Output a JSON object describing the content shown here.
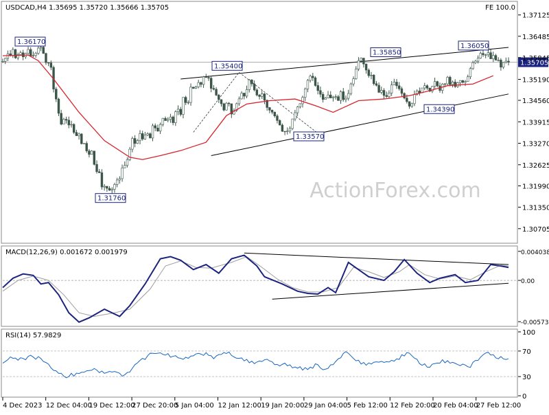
{
  "header": {
    "symbol_text": "USDCAD,H4  1.35695 1.35720 1.35666 1.35705",
    "fe_text": "FE 100.0"
  },
  "watermark": "ActionForex.com",
  "colors": {
    "candle": "#3b5548",
    "ma": "#d8232a",
    "macd_line": "#1a237e",
    "macd_signal": "#9e9e9e",
    "rsi": "#1565c0",
    "trendline": "#000000",
    "label_border": "#1a237e",
    "label_text": "#1a237e",
    "last_price_bg": "#1a237e",
    "watermark": "#cfcfcf"
  },
  "chart_data": [
    {
      "type": "candlestick",
      "panel": "price",
      "title": "USDCAD,H4",
      "ohlc_header": {
        "open": 1.35695,
        "high": 1.3572,
        "low": 1.35666,
        "close": 1.35705
      },
      "last_price": 1.35705,
      "ylim": [
        1.3035,
        1.3745
      ],
      "y_ticks": [
        1.37125,
        1.36485,
        1.35845,
        1.3519,
        1.3456,
        1.33915,
        1.3327,
        1.32625,
        1.3199,
        1.3135,
        1.30705
      ],
      "y_tick_labels": [
        "1.37125",
        "1.36485",
        "1.35845",
        "1.35190",
        "1.34560",
        "1.33915",
        "1.33270",
        "1.32625",
        "1.31990",
        "1.31350",
        "1.30705"
      ],
      "x_labels": [
        "4 Dec 2023",
        "12 Dec 04:00",
        "19 Dec 12:00",
        "27 Dec 20:00",
        "5 Jan 04:00",
        "12 Jan 12:00",
        "19 Jan 20:00",
        "29 Jan 04:00",
        "5 Feb 12:00",
        "12 Feb 20:00",
        "20 Feb 04:00",
        "27 Feb 12:00"
      ],
      "price_path": [
        [
          1.3575,
          1.3595,
          1.359,
          1.3605,
          1.358,
          1.36,
          1.359,
          1.361,
          1.359,
          1.3585,
          1.36,
          1.3617,
          1.359,
          1.357
        ],
        [
          1.356,
          1.347,
          1.344,
          1.339,
          1.34,
          1.338,
          1.339,
          1.335,
          1.336,
          1.332,
          1.333,
          1.329
        ],
        [
          1.33,
          1.325,
          1.324,
          1.32,
          1.319,
          1.3176,
          1.3185,
          1.32,
          1.322,
          1.325,
          1.327
        ],
        [
          1.33,
          1.334,
          1.332,
          1.336,
          1.333,
          1.337,
          1.334,
          1.339,
          1.335,
          1.338,
          1.34
        ],
        [
          1.338,
          1.341,
          1.339,
          1.344,
          1.341,
          1.347,
          1.344,
          1.35,
          1.348,
          1.352
        ],
        [
          1.351,
          1.354,
          1.352,
          1.35,
          1.348,
          1.347,
          1.344,
          1.343,
          1.345,
          1.342,
          1.344
        ],
        [
          1.346,
          1.348,
          1.347,
          1.351,
          1.35,
          1.348,
          1.346,
          1.347,
          1.344,
          1.343
        ],
        [
          1.342,
          1.34,
          1.338,
          1.337,
          1.3357,
          1.337,
          1.34,
          1.342
        ],
        [
          1.345,
          1.347,
          1.35,
          1.353,
          1.351,
          1.348,
          1.347,
          1.346,
          1.347,
          1.346
        ],
        [
          1.347,
          1.346,
          1.348,
          1.345,
          1.347,
          1.35,
          1.353,
          1.357,
          1.3585,
          1.356
        ],
        [
          1.354,
          1.352,
          1.35,
          1.348,
          1.349,
          1.347,
          1.348,
          1.35,
          1.351
        ],
        [
          1.349,
          1.347,
          1.345,
          1.3439,
          1.346,
          1.348,
          1.347,
          1.349
        ],
        [
          1.35,
          1.349,
          1.351,
          1.35,
          1.349,
          1.35,
          1.352
        ],
        [
          1.351,
          1.35,
          1.351,
          1.352,
          1.351,
          1.353,
          1.355,
          1.357,
          1.359,
          1.3605
        ],
        [
          1.359,
          1.36,
          1.358,
          1.359,
          1.357,
          1.356,
          1.3575,
          1.357
        ]
      ],
      "annotations": [
        {
          "text": "1.36170",
          "price": 1.3617,
          "position": "top-left"
        },
        {
          "text": "1.31760",
          "price": 1.3176,
          "position": "bottom"
        },
        {
          "text": "1.35400",
          "price": 1.354,
          "position": "upper-middle"
        },
        {
          "text": "1.33570",
          "price": 1.3357,
          "position": "lower-middle"
        },
        {
          "text": "1.35850",
          "price": 1.3585,
          "position": "upper-right"
        },
        {
          "text": "1.34390",
          "price": 1.3439,
          "position": "right"
        },
        {
          "text": "1.36050",
          "price": 1.3605,
          "position": "top-right"
        }
      ],
      "moving_average": {
        "color": "#d8232a",
        "points": [
          [
            0,
            1.359
          ],
          [
            10,
            1.3592
          ],
          [
            14,
            1.3575
          ],
          [
            20,
            1.352
          ],
          [
            30,
            1.342
          ],
          [
            40,
            1.3335
          ],
          [
            50,
            1.3285
          ],
          [
            55,
            1.3278
          ],
          [
            62,
            1.329
          ],
          [
            70,
            1.3305
          ],
          [
            80,
            1.333
          ],
          [
            88,
            1.341
          ],
          [
            96,
            1.3445
          ],
          [
            105,
            1.3455
          ],
          [
            115,
            1.346
          ],
          [
            123,
            1.344
          ],
          [
            130,
            1.342
          ],
          [
            140,
            1.3455
          ],
          [
            150,
            1.346
          ],
          [
            160,
            1.347
          ],
          [
            168,
            1.3485
          ],
          [
            175,
            1.35
          ],
          [
            185,
            1.3505
          ],
          [
            193,
            1.353
          ]
        ]
      },
      "trendlines": [
        {
          "kind": "upper-channel",
          "from": [
            70,
            1.352
          ],
          "to": [
            199,
            1.3615
          ]
        },
        {
          "kind": "lower-channel",
          "from": [
            82,
            1.329
          ],
          "to": [
            199,
            1.3475
          ]
        }
      ],
      "dashed_lines": [
        {
          "from": [
            75,
            1.336
          ],
          "to": [
            93,
            1.354
          ]
        },
        {
          "from": [
            93,
            1.354
          ],
          "to": [
            124,
            1.3357
          ]
        }
      ]
    },
    {
      "type": "line",
      "panel": "macd",
      "title": "MACD(12,26,9) 0.001672 0.001979",
      "macd": 0.001672,
      "signal_value": 0.001979,
      "ylim": [
        -0.0061,
        0.0044
      ],
      "y_ticks": [
        0.004038,
        0.0,
        -0.005737
      ],
      "y_tick_labels": [
        "0.004038",
        "0.00",
        "-0.005737"
      ],
      "macd_line": [
        [
          0,
          -0.001
        ],
        [
          4,
          0.0003
        ],
        [
          8,
          0.0009
        ],
        [
          12,
          0.0007
        ],
        [
          15,
          -0.0005
        ],
        [
          18,
          -0.0003
        ],
        [
          22,
          -0.002
        ],
        [
          26,
          -0.0045
        ],
        [
          30,
          -0.0058
        ],
        [
          34,
          -0.0052
        ],
        [
          40,
          -0.004
        ],
        [
          46,
          -0.005
        ],
        [
          50,
          -0.0035
        ],
        [
          56,
          -0.0005
        ],
        [
          62,
          0.003
        ],
        [
          66,
          0.0033
        ],
        [
          70,
          0.0028
        ],
        [
          75,
          0.0015
        ],
        [
          80,
          0.0022
        ],
        [
          85,
          0.001
        ],
        [
          90,
          0.003
        ],
        [
          95,
          0.0035
        ],
        [
          100,
          0.002
        ],
        [
          103,
          0.0005
        ],
        [
          110,
          -0.0005
        ],
        [
          116,
          -0.0015
        ],
        [
          120,
          -0.0018
        ],
        [
          124,
          -0.0019
        ],
        [
          128,
          -0.001
        ],
        [
          131,
          -0.0017
        ],
        [
          136,
          0.0025
        ],
        [
          140,
          0.0015
        ],
        [
          144,
          0.0005
        ],
        [
          150,
          0.0
        ],
        [
          154,
          0.0012
        ],
        [
          158,
          0.0029
        ],
        [
          163,
          0.001
        ],
        [
          168,
          -0.0003
        ],
        [
          172,
          0.0003
        ],
        [
          178,
          0.0008
        ],
        [
          182,
          -0.0003
        ],
        [
          187,
          0.0
        ],
        [
          192,
          0.0022
        ],
        [
          196,
          0.002
        ],
        [
          199,
          0.0018
        ]
      ],
      "signal_line": [
        [
          0,
          -0.0015
        ],
        [
          6,
          0.0
        ],
        [
          12,
          0.0006
        ],
        [
          18,
          0.0
        ],
        [
          24,
          -0.002
        ],
        [
          30,
          -0.0045
        ],
        [
          36,
          -0.005
        ],
        [
          44,
          -0.0045
        ],
        [
          50,
          -0.004
        ],
        [
          58,
          -0.0012
        ],
        [
          64,
          0.002
        ],
        [
          70,
          0.0027
        ],
        [
          76,
          0.0018
        ],
        [
          82,
          0.0017
        ],
        [
          90,
          0.0025
        ],
        [
          96,
          0.0033
        ],
        [
          102,
          0.0018
        ],
        [
          108,
          0.0002
        ],
        [
          114,
          -0.001
        ],
        [
          120,
          -0.0016
        ],
        [
          126,
          -0.0016
        ],
        [
          132,
          -0.001
        ],
        [
          138,
          0.0018
        ],
        [
          144,
          0.0012
        ],
        [
          150,
          0.0004
        ],
        [
          156,
          0.0012
        ],
        [
          160,
          0.0022
        ],
        [
          166,
          0.0008
        ],
        [
          172,
          0.0002
        ],
        [
          178,
          0.0006
        ],
        [
          184,
          0.0001
        ],
        [
          190,
          0.0012
        ],
        [
          196,
          0.0021
        ],
        [
          199,
          0.002
        ]
      ],
      "trendlines": [
        {
          "kind": "upper",
          "from": [
            95,
            0.0038
          ],
          "to": [
            199,
            0.0022
          ]
        },
        {
          "kind": "lower",
          "from": [
            106,
            -0.0026
          ],
          "to": [
            199,
            -0.0004
          ]
        }
      ]
    },
    {
      "type": "line",
      "panel": "rsi",
      "title": "RSI(14) 57.9829",
      "value": 57.9829,
      "ylim": [
        0,
        100
      ],
      "y_ticks": [
        100,
        70,
        30,
        0
      ],
      "y_tick_labels": [
        "100",
        "70",
        "30",
        "0"
      ],
      "rsi_line": [
        [
          0,
          52
        ],
        [
          4,
          60
        ],
        [
          8,
          56
        ],
        [
          12,
          62
        ],
        [
          16,
          55
        ],
        [
          20,
          42
        ],
        [
          24,
          30
        ],
        [
          28,
          33
        ],
        [
          32,
          36
        ],
        [
          36,
          40
        ],
        [
          40,
          35
        ],
        [
          44,
          38
        ],
        [
          48,
          32
        ],
        [
          52,
          45
        ],
        [
          56,
          58
        ],
        [
          60,
          68
        ],
        [
          64,
          64
        ],
        [
          68,
          62
        ],
        [
          72,
          58
        ],
        [
          76,
          63
        ],
        [
          80,
          66
        ],
        [
          84,
          60
        ],
        [
          88,
          70
        ],
        [
          92,
          62
        ],
        [
          96,
          55
        ],
        [
          100,
          52
        ],
        [
          104,
          58
        ],
        [
          108,
          50
        ],
        [
          112,
          48
        ],
        [
          116,
          45
        ],
        [
          120,
          42
        ],
        [
          124,
          48
        ],
        [
          128,
          40
        ],
        [
          132,
          55
        ],
        [
          136,
          68
        ],
        [
          140,
          55
        ],
        [
          144,
          48
        ],
        [
          148,
          52
        ],
        [
          152,
          55
        ],
        [
          156,
          58
        ],
        [
          160,
          66
        ],
        [
          164,
          55
        ],
        [
          168,
          45
        ],
        [
          172,
          52
        ],
        [
          176,
          55
        ],
        [
          180,
          50
        ],
        [
          184,
          45
        ],
        [
          188,
          55
        ],
        [
          192,
          68
        ],
        [
          196,
          60
        ],
        [
          199,
          58
        ]
      ]
    }
  ]
}
